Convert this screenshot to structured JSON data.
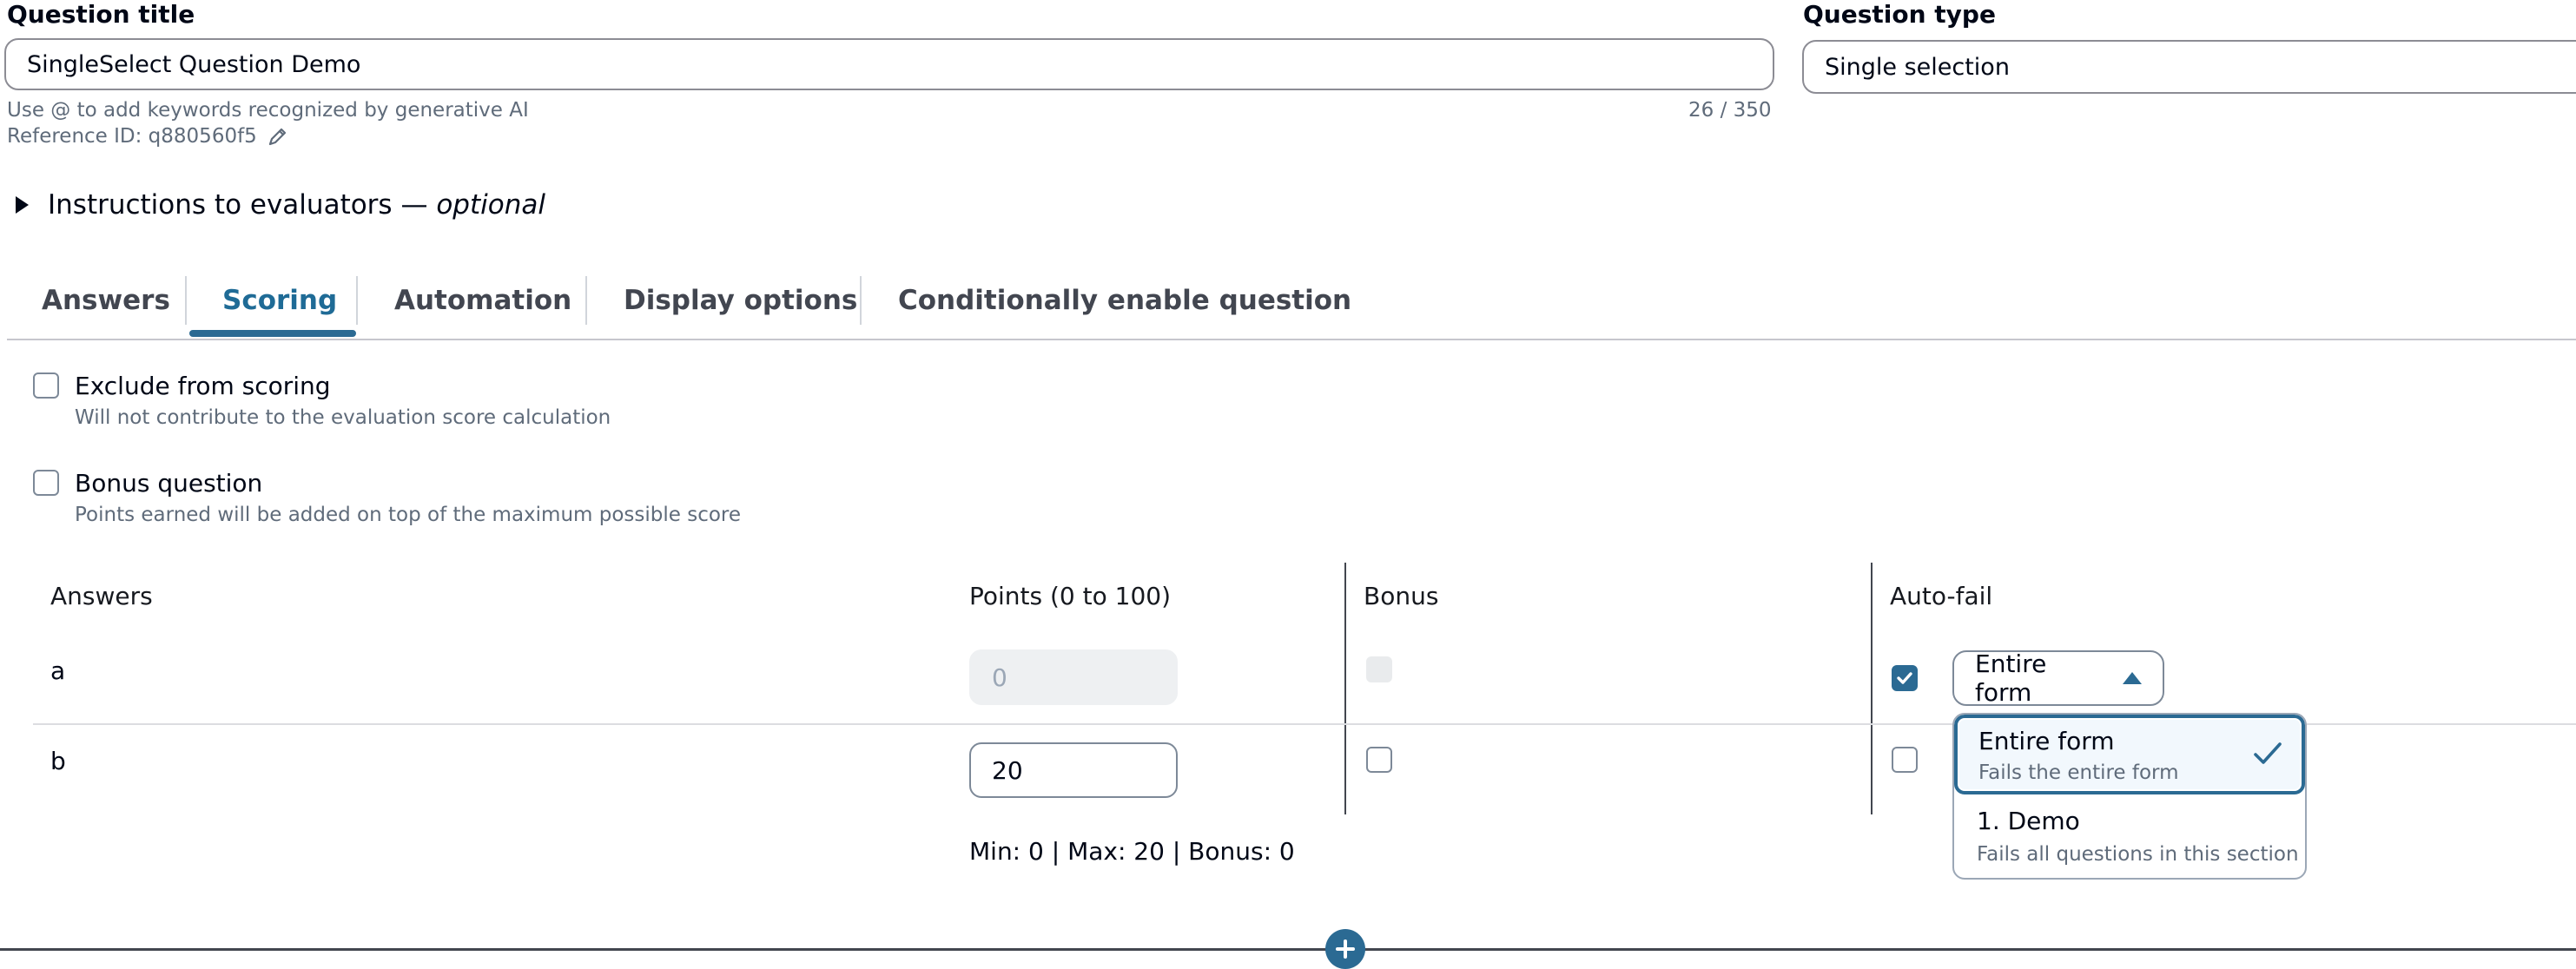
{
  "question_title": {
    "label": "Question title",
    "value": "SingleSelect Question Demo",
    "hint": "Use @ to add keywords recognized by generative AI",
    "char_count": "26 / 350",
    "reference": "Reference ID: q880560f5"
  },
  "question_type": {
    "label": "Question type",
    "value": "Single selection"
  },
  "instructions": {
    "label": "Instructions to evaluators",
    "dash": " — ",
    "optional": "optional"
  },
  "tabs": [
    {
      "label": "Answers"
    },
    {
      "label": "Scoring"
    },
    {
      "label": "Automation"
    },
    {
      "label": "Display options"
    },
    {
      "label": "Conditionally enable question"
    }
  ],
  "scoring": {
    "exclude": {
      "title": "Exclude from scoring",
      "desc": "Will not contribute to the evaluation score calculation"
    },
    "bonus": {
      "title": "Bonus question",
      "desc": "Points earned will be added on top of the maximum possible score"
    }
  },
  "table": {
    "headers": {
      "answers": "Answers",
      "points": "Points (0 to 100)",
      "bonus": "Bonus",
      "autofail": "Auto-fail"
    },
    "rows": [
      {
        "answer": "a",
        "points": "0",
        "points_disabled": true,
        "bonus_disabled": true,
        "autofail_checked": true,
        "autofail_scope": "Entire form"
      },
      {
        "answer": "b",
        "points": "20",
        "points_disabled": false,
        "bonus_disabled": false,
        "autofail_checked": false
      }
    ],
    "summary": "Min: 0 | Max: 20 | Bonus: 0"
  },
  "dropdown": {
    "options": [
      {
        "title": "Entire form",
        "desc": "Fails the entire form",
        "selected": true
      },
      {
        "title": "1. Demo",
        "desc": "Fails all questions in this section",
        "selected": false
      }
    ]
  },
  "colors": {
    "accent": "#2b6a93",
    "text": "#000716",
    "muted": "#5f6b7a"
  }
}
